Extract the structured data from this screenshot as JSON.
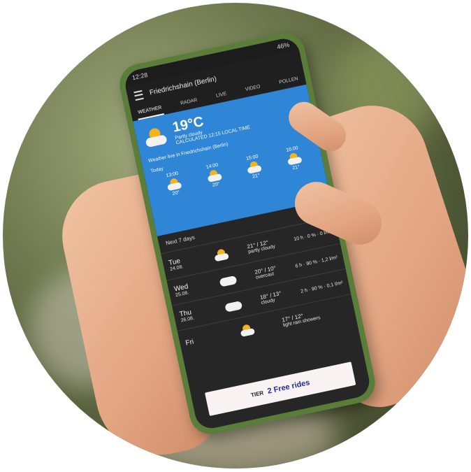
{
  "status": {
    "time": "12:28",
    "indicators": "46%"
  },
  "topbar": {
    "location": "Friedrichshain (Berlin)"
  },
  "tabs": [
    {
      "label": "WEATHER"
    },
    {
      "label": "RADAR"
    },
    {
      "label": "LIVE"
    },
    {
      "label": "VIDEO"
    },
    {
      "label": "POLLEN"
    }
  ],
  "hero": {
    "temperature": "19°C",
    "condition": "Partly cloudy",
    "feels": "CALCULATED 12:15 LOCAL TIME",
    "live_label": "Weather live in Friedrichshain (Berlin)",
    "today_label": "Today",
    "hours": [
      {
        "time": "13:00",
        "temp": "20°"
      },
      {
        "time": "14:00",
        "temp": "20°"
      },
      {
        "time": "15:00",
        "temp": "21°"
      },
      {
        "time": "16:00",
        "temp": "21°"
      }
    ]
  },
  "forecast": {
    "header": "Next 7 days",
    "days": [
      {
        "name": "Tue",
        "date": "24.08.",
        "temp": "21° / 12°",
        "cond": "partly cloudy",
        "sun": "10 h",
        "rain": "0 %",
        "wind": "0 l/m²"
      },
      {
        "name": "Wed",
        "date": "25.08.",
        "temp": "20° / 10°",
        "cond": "overcast",
        "sun": "6 h",
        "rain": "90 %",
        "wind": "1,2 l/m²"
      },
      {
        "name": "Thu",
        "date": "26.08.",
        "temp": "18° / 13°",
        "cond": "cloudy",
        "sun": "2 h",
        "rain": "90 %",
        "wind": "0,1 l/m²"
      },
      {
        "name": "Fri",
        "date": "",
        "temp": "17° / 12°",
        "cond": "light rain showers",
        "sun": "",
        "rain": "",
        "wind": ""
      }
    ]
  },
  "ad": {
    "brand": "TIER",
    "headline": "2 Free rides"
  },
  "colors": {
    "hero_blue": "#2f86d6",
    "phone_green": "#5a7d3a"
  }
}
